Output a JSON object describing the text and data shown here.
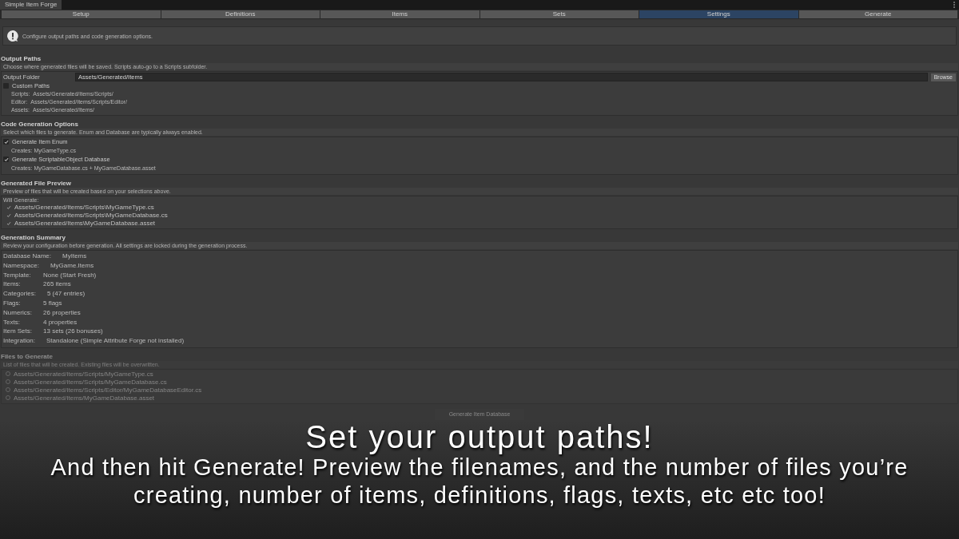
{
  "window": {
    "title": "Simple Item Forge"
  },
  "tabs": [
    {
      "label": "Setup",
      "selected": false
    },
    {
      "label": "Definitions",
      "selected": false
    },
    {
      "label": "Items",
      "selected": false
    },
    {
      "label": "Sets",
      "selected": false
    },
    {
      "label": "Settings",
      "selected": true
    },
    {
      "label": "Generate",
      "selected": false
    }
  ],
  "info": "Configure output paths and code generation options.",
  "output_paths": {
    "title": "Output Paths",
    "help": "Choose where generated files will be saved. Scripts auto-go to a Scripts subfolder.",
    "folder_label": "Output Folder",
    "folder_value": "Assets/Generated/Items",
    "browse": "Browse",
    "custom_paths": {
      "label": "Custom Paths",
      "checked": false
    },
    "paths": [
      {
        "label": "Scripts:",
        "value": "Assets/Generated/Items/Scripts/"
      },
      {
        "label": "Editor:",
        "value": "Assets/Generated/Items/Scripts/Editor/"
      },
      {
        "label": "Assets:",
        "value": "Assets/Generated/Items/"
      }
    ]
  },
  "code_generation": {
    "title": "Code Generation Options",
    "help": "Select which files to generate. Enum and Database are typically always enabled.",
    "options": [
      {
        "label": "Generate Item Enum",
        "checked": true,
        "creates": "Creates: MyGameType.cs"
      },
      {
        "label": "Generate ScriptableObject Database",
        "checked": true,
        "creates": "Creates: MyGameDatabase.cs + MyGameDatabase.asset"
      }
    ]
  },
  "file_preview": {
    "title": "Generated File Preview",
    "help": "Preview of files that will be created based on your selections above.",
    "heading": "Will Generate:",
    "files": [
      "Assets/Generated/Items/Scripts\\MyGameType.cs",
      "Assets/Generated/Items/Scripts\\MyGameDatabase.cs",
      "Assets/Generated/Items\\MyGameDatabase.asset"
    ]
  },
  "summary": {
    "title": "Generation Summary",
    "help": "Review your configuration before generation. All settings are locked during the generation process.",
    "rows": [
      {
        "label": "Database Name:",
        "value": "MyItems"
      },
      {
        "label": "Namespace:",
        "value": "MyGame.Items"
      },
      {
        "label": "Template:",
        "value": "None (Start Fresh)"
      },
      {
        "label": "Items:",
        "value": "265 items"
      },
      {
        "label": "Categories:",
        "value": "5 (47 entries)"
      },
      {
        "label": "Flags:",
        "value": "5 flags"
      },
      {
        "label": "Numerics:",
        "value": "26 properties"
      },
      {
        "label": "Texts:",
        "value": "4 properties"
      },
      {
        "label": "Item Sets:",
        "value": "13 sets (26 bonuses)"
      },
      {
        "label": "Integration:",
        "value": "Standalone (Simple Attribute Forge not installed)"
      }
    ]
  },
  "files_to_generate": {
    "title": "Files to Generate",
    "help": "List of files that will be created. Existing files will be overwritten.",
    "files": [
      "Assets/Generated/Items/Scripts/MyGameType.cs",
      "Assets/Generated/Items/Scripts/MyGameDatabase.cs",
      "Assets/Generated/Items/Scripts/Editor/MyGameDatabaseEditor.cs",
      "Assets/Generated/Items/MyGameDatabase.asset"
    ]
  },
  "generate_button": "Generate Item Database",
  "caption": {
    "headline": "Set your output paths!",
    "body": "And then hit Generate! Preview the filenames, and the number of files you’re creating, number of items, definitions, flags, texts, etc etc too!"
  }
}
